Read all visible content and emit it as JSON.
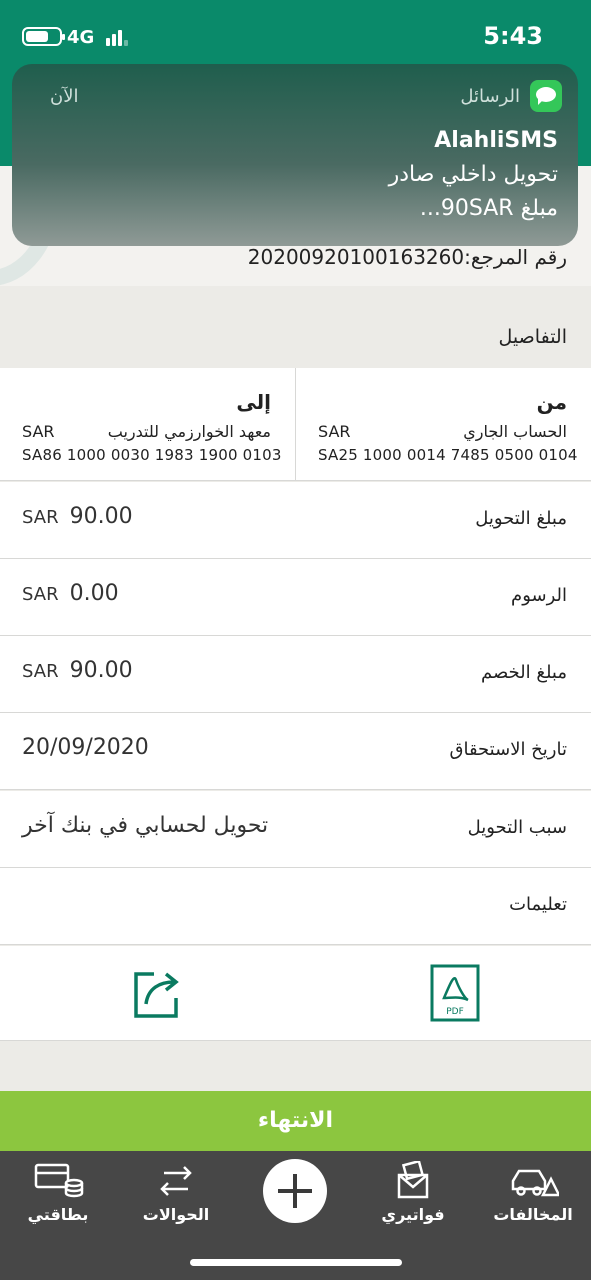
{
  "status": {
    "network": "4G",
    "time": "5:43"
  },
  "notification": {
    "app_name": "الرسائل",
    "time": "الآن",
    "sender": "AlahliSMS",
    "line1": "تحويل داخلي صادر",
    "line2": "مبلغ 90SAR..."
  },
  "reference": "رقم المرجع:20200920100163260",
  "section_title": "التفاصيل",
  "from": {
    "title": "من",
    "account_name": "الحساب الجاري",
    "currency": "SAR",
    "iban": "SA25 1000 0014 7485 0500 0104"
  },
  "to": {
    "title": "إلى",
    "account_name": "معهد الخوارزمي للتدريب",
    "currency": "SAR",
    "iban": "SA86 1000 0030 1983 1900 0103"
  },
  "details": [
    {
      "label": "مبلغ التحويل",
      "currency": "SAR",
      "value": "90.00"
    },
    {
      "label": "الرسوم",
      "currency": "SAR",
      "value": "0.00"
    },
    {
      "label": "مبلغ الخصم",
      "currency": "SAR",
      "value": "90.00"
    },
    {
      "label": "تاريخ الاستحقاق",
      "currency": "",
      "value": "20/09/2020"
    },
    {
      "label": "سبب التحويل",
      "currency": "",
      "value": "تحويل لحسابي في بنك آخر"
    },
    {
      "label": "تعليمات",
      "currency": "",
      "value": ""
    }
  ],
  "actions": {
    "pdf_icon": "pdf-icon",
    "share_icon": "share-icon",
    "pdf_text": "PDF"
  },
  "finish_label": "الانتهاء",
  "tabs": [
    {
      "label": "المخالفات",
      "icon": "car-warning-icon"
    },
    {
      "label": "فواتيري",
      "icon": "bill-envelope-icon"
    },
    {
      "label": "",
      "icon": "plus-icon"
    },
    {
      "label": "الحوالات",
      "icon": "transfer-arrows-icon"
    },
    {
      "label": "بطاقتي",
      "icon": "cards-coins-icon"
    }
  ],
  "colors": {
    "brand_green": "#0a8a6a",
    "finish_green": "#8cc63f",
    "tabbar": "#474747"
  }
}
